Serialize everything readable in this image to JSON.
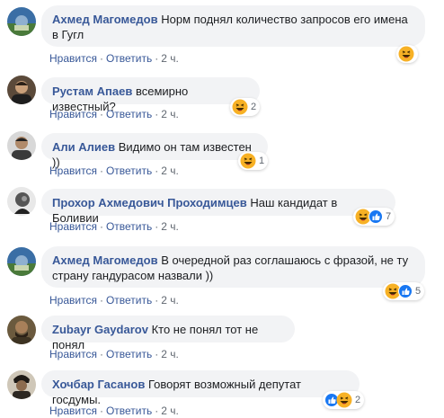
{
  "colors": {
    "author": "#385898",
    "bubble": "#f2f3f5",
    "meta": "#606770",
    "haha": "#f7b125",
    "like": "#1877f2"
  },
  "actions": {
    "like_label": "Нравится",
    "reply_label": "Ответить",
    "dot": "·"
  },
  "comments": [
    {
      "author": "Ахмед Магомедов",
      "text": "Норм поднял количество запросов его имена в Гугл",
      "time": "2 ч.",
      "reaction_icons": [
        "haha-icon"
      ],
      "reaction_count": ""
    },
    {
      "author": "Рустам Апаев",
      "text": "всемирно известный?",
      "time": "2 ч.",
      "reaction_icons": [
        "haha-icon"
      ],
      "reaction_count": "2"
    },
    {
      "author": "Али Алиев",
      "text": "Видимо он там известен ))",
      "time": "2 ч.",
      "reaction_icons": [
        "haha-icon"
      ],
      "reaction_count": "1"
    },
    {
      "author": "Прохор Ахмедович Проходимцев",
      "text": "Наш кандидат в Боливии",
      "time": "2 ч.",
      "reaction_icons": [
        "haha-icon",
        "like-icon"
      ],
      "reaction_count": "7"
    },
    {
      "author": "Ахмед Магомедов",
      "text": "В очередной раз соглашаюсь с фразой, не ту страну гандурасом назвали ))",
      "time": "2 ч.",
      "reaction_icons": [
        "haha-icon",
        "like-icon"
      ],
      "reaction_count": "5"
    },
    {
      "author": "Zubayr Gaydarov",
      "text": "Кто не понял тот не понял",
      "time": "2 ч.",
      "reaction_icons": [],
      "reaction_count": ""
    },
    {
      "author": "Хочбар Гасанов",
      "text": "Говорят возможный депутат госдумы.",
      "time": "2 ч.",
      "reaction_icons": [
        "like-icon",
        "haha-icon"
      ],
      "reaction_count": "2"
    }
  ]
}
